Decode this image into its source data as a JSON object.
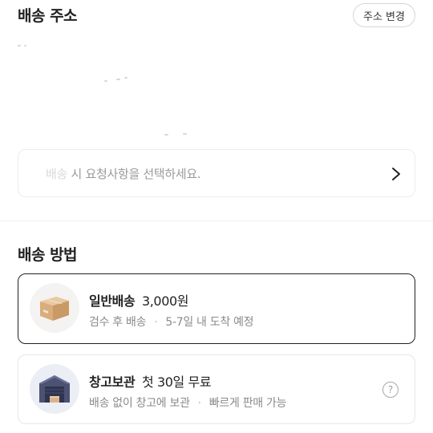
{
  "address": {
    "title": "배송 주소",
    "change_button": "주소 변경",
    "request_prefix": "배송",
    "request_placeholder": "시 요청사항을 선택하세요."
  },
  "method": {
    "title": "배송 방법",
    "options": [
      {
        "name": "일반배송",
        "price": "3,000원",
        "detail_1": "검수 후 배송",
        "detail_2": "5-7일 내 도착 예정",
        "icon": "package-box-icon",
        "selected": true
      },
      {
        "name": "창고보관",
        "price": "첫 30일 무료",
        "detail_1": "배송 없이 창고에 보관",
        "detail_2": "빠르게 판매 가능",
        "icon": "warehouse-icon",
        "selected": false
      }
    ],
    "separator": "·"
  },
  "colors": {
    "selected_border": "#222222",
    "box_brown": "#d9b48a",
    "warehouse_navy": "#4b5272"
  }
}
